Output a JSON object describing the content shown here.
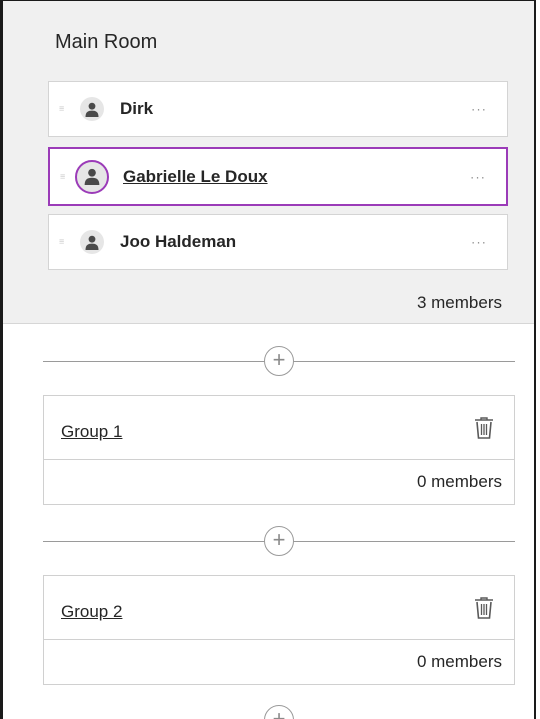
{
  "main_room": {
    "title": "Main Room",
    "members": [
      {
        "name": "Dirk",
        "menu": "···",
        "selected": false
      },
      {
        "name": "Gabrielle Le Doux",
        "menu": "···",
        "selected": true
      },
      {
        "name": "Joo Haldeman",
        "menu": "···",
        "selected": false
      }
    ],
    "count": "3 members"
  },
  "groups": [
    {
      "name": "Group 1",
      "count": "0 members"
    },
    {
      "name": "Group 2",
      "count": "0 members"
    }
  ],
  "add_glyph": "+",
  "colors": {
    "accent": "#9b3bb8",
    "panel_bg": "#f0f0f0"
  },
  "icons": {
    "avatar": "person-icon",
    "delete": "trash-icon",
    "drag": "drag-handle-icon",
    "add": "plus-circle-icon",
    "more": "more-options-icon"
  }
}
